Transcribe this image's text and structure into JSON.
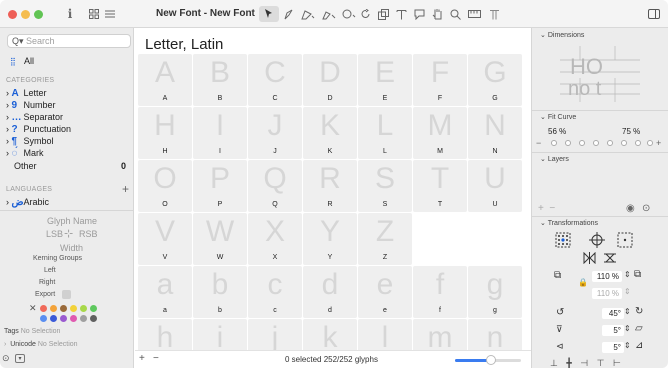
{
  "window": {
    "title": "New Font - New Font"
  },
  "toolbar": {
    "info_label": "i"
  },
  "sidebar": {
    "search_placeholder": "Search",
    "all_label": "All",
    "categories_header": "CATEGORIES",
    "categories": [
      {
        "label": "Letter",
        "icon": "A"
      },
      {
        "label": "Number",
        "icon": "9"
      },
      {
        "label": "Separator",
        "icon": "…"
      },
      {
        "label": "Punctuation",
        "icon": "?"
      },
      {
        "label": "Symbol",
        "icon": "¶"
      },
      {
        "label": "Mark",
        "icon": "◌́"
      }
    ],
    "other_label": "Other",
    "other_count": "0",
    "languages_header": "LANGUAGES",
    "languages": [
      {
        "label": "Arabic",
        "icon": "ض"
      }
    ],
    "glyph_name_label": "Glyph Name",
    "lsb_label": "LSB",
    "rsb_label": "RSB",
    "width_label": "Width",
    "kerning_groups_label": "Kerning Groups",
    "left_label": "Left",
    "right_label": "Right",
    "export_label": "Export",
    "tags_label": "Tags",
    "tags_value": "No Selection",
    "unicode_label": "Unicode",
    "unicode_value": "No Selection",
    "colors": [
      "#f06a5a",
      "#f3a33a",
      "#9a6a3a",
      "#f2d23a",
      "#a8d84a",
      "#5ec85e",
      "#5a8ef0",
      "#3a5ad8",
      "#9a5ad0",
      "#e05ab0",
      "#a0a0a0",
      "#606060"
    ]
  },
  "main": {
    "category_title": "Letter, Latin",
    "glyphs": [
      {
        "g": "A",
        "n": "A"
      },
      {
        "g": "B",
        "n": "B"
      },
      {
        "g": "C",
        "n": "C"
      },
      {
        "g": "D",
        "n": "D"
      },
      {
        "g": "E",
        "n": "E"
      },
      {
        "g": "F",
        "n": "F"
      },
      {
        "g": "G",
        "n": "G"
      },
      {
        "g": "H",
        "n": "H"
      },
      {
        "g": "I",
        "n": "I"
      },
      {
        "g": "J",
        "n": "J"
      },
      {
        "g": "K",
        "n": "K"
      },
      {
        "g": "L",
        "n": "L"
      },
      {
        "g": "M",
        "n": "M"
      },
      {
        "g": "N",
        "n": "N"
      },
      {
        "g": "O",
        "n": "O"
      },
      {
        "g": "P",
        "n": "P"
      },
      {
        "g": "Q",
        "n": "Q"
      },
      {
        "g": "R",
        "n": "R"
      },
      {
        "g": "S",
        "n": "S"
      },
      {
        "g": "T",
        "n": "T"
      },
      {
        "g": "U",
        "n": "U"
      },
      {
        "g": "V",
        "n": "V"
      },
      {
        "g": "W",
        "n": "W"
      },
      {
        "g": "X",
        "n": "X"
      },
      {
        "g": "Y",
        "n": "Y"
      },
      {
        "g": "Z",
        "n": "Z"
      },
      {
        "g": "a",
        "n": "a"
      },
      {
        "g": "b",
        "n": "b"
      },
      {
        "g": "c",
        "n": "c"
      },
      {
        "g": "d",
        "n": "d"
      },
      {
        "g": "e",
        "n": "e"
      },
      {
        "g": "f",
        "n": "f"
      },
      {
        "g": "g",
        "n": "g"
      },
      {
        "g": "h",
        "n": ""
      },
      {
        "g": "i",
        "n": ""
      },
      {
        "g": "j",
        "n": ""
      },
      {
        "g": "k",
        "n": ""
      },
      {
        "g": "l",
        "n": ""
      },
      {
        "g": "m",
        "n": ""
      },
      {
        "g": "n",
        "n": ""
      }
    ],
    "status": "0 selected 252/252 glyphs",
    "add_label": "+",
    "remove_label": "−",
    "zoom_level": 0.55
  },
  "rpanel": {
    "dimensions_label": "Dimensions",
    "fit_curve_label": "Fit Curve",
    "fit_left": "56 %",
    "fit_right": "75 %",
    "layers_label": "Layers",
    "transformations_label": "Transformations",
    "scale_value": "110 %",
    "scale_value2": "110 %",
    "rotate_value": "45°",
    "slant_value": "5°",
    "slant_value2": "5°",
    "dim_preview_top": "HO",
    "dim_preview_bottom": "no t"
  }
}
